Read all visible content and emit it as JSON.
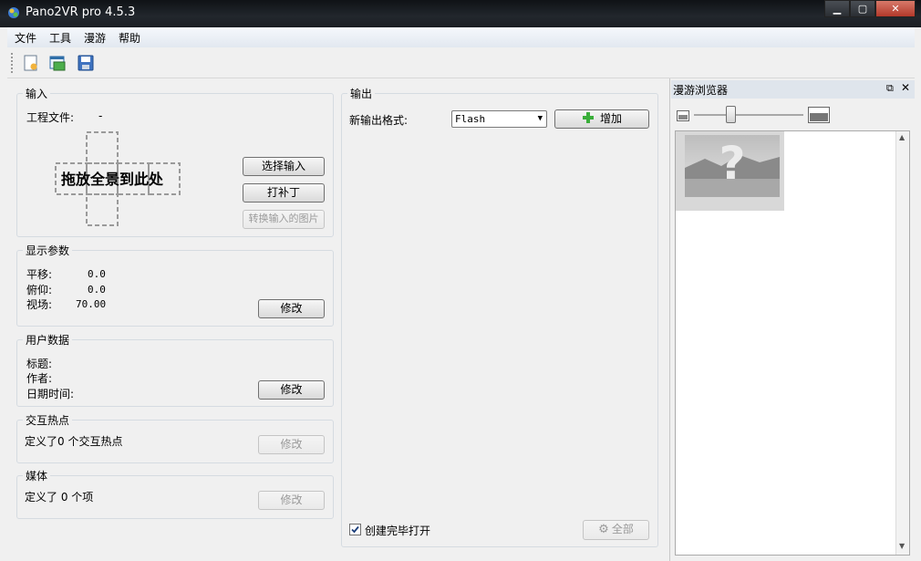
{
  "window": {
    "title": "Pano2VR pro 4.5.3"
  },
  "menu": [
    "文件",
    "工具",
    "漫游",
    "帮助"
  ],
  "toolbar_icons": [
    "new-project-icon",
    "open-project-icon",
    "save-icon"
  ],
  "input_group": {
    "title": "输入",
    "project_label": "工程文件:",
    "project_value": "-",
    "drop_text": "拖放全景到此处",
    "select_input": "选择输入",
    "patch": "打补丁",
    "convert": "转换输入的图片"
  },
  "display_params": {
    "title": "显示参数",
    "pan_label": "平移:",
    "pan_value": "0.0",
    "tilt_label": "俯仰:",
    "tilt_value": "0.0",
    "fov_label": "视场:",
    "fov_value": "70.00",
    "modify": "修改"
  },
  "user_data": {
    "title": "用户数据",
    "title_label": "标题:",
    "author_label": "作者:",
    "datetime_label": "日期时间:",
    "modify": "修改"
  },
  "hotspots": {
    "title": "交互热点",
    "text": "定义了0 个交互热点",
    "modify": "修改"
  },
  "media": {
    "title": "媒体",
    "text": "定义了 0 个项",
    "modify": "修改"
  },
  "output": {
    "title": "输出",
    "format_label": "新输出格式:",
    "format_value": "Flash",
    "add": "增加",
    "open_after": "创建完毕打开",
    "open_after_checked": true,
    "all": "全部"
  },
  "tour_browser": {
    "title": "漫游浏览器"
  }
}
